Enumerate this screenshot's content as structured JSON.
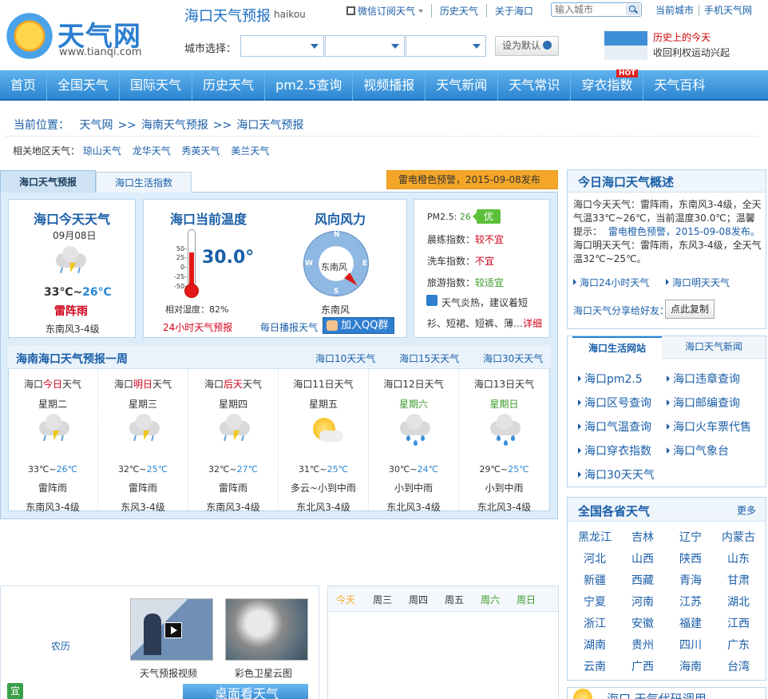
{
  "header": {
    "logo_text": "天气网",
    "logo_url": "www.tianqi.com",
    "city_title": "海口天气预报",
    "city_pinyin": "haikou",
    "top_links": [
      "微信订阅天气",
      "历史天气",
      "关于海口"
    ],
    "search_placeholder": "输入城市",
    "right_links": [
      "当前城市",
      "手机天气网"
    ],
    "city_select_label": "城市选择：",
    "set_default": "设为默认",
    "history_title": "历史上的今天",
    "history_text": "收回利权运动兴起"
  },
  "nav": {
    "items": [
      "首页",
      "全国天气",
      "国际天气",
      "历史天气",
      "pm2.5查询",
      "视频播报",
      "天气新闻",
      "天气常识",
      "穿衣指数",
      "天气百科"
    ],
    "hot_badge": "HOT"
  },
  "breadcrumb": {
    "label": "当前位置：",
    "items": [
      "天气网",
      "海南天气预报",
      "海口天气预报"
    ]
  },
  "related": {
    "label": "相关地区天气：",
    "items": [
      "琼山天气",
      "龙华天气",
      "秀英天气",
      "美兰天气"
    ]
  },
  "tabs": [
    "海口天气预报",
    "海口生活指数"
  ],
  "warning": "雷电橙色预警，2015-09-08发布",
  "today": {
    "title": "海口今天天气",
    "date": "09月08日",
    "high": "33℃",
    "tilde": "~",
    "low": "26℃",
    "condition": "雷阵雨",
    "wind": "东南风3-4级"
  },
  "current": {
    "title": "海口当前温度",
    "temp": "30.0°",
    "scale": [
      "50-",
      "25-",
      "0-",
      "-25-",
      "-50-"
    ],
    "humidity": "相对湿度：82%",
    "forecast_link": "24小时天气预报"
  },
  "wind": {
    "title": "风向风力",
    "direction": "东南风",
    "label": "东南风",
    "dirs": [
      "N",
      "S",
      "W",
      "E"
    ],
    "daily_link": "每日播报天气",
    "qq_button": "加入QQ群"
  },
  "indices": {
    "pm_label": "PM2.5:",
    "pm_value": "26",
    "pm_badge": "优",
    "items": [
      {
        "label": "晨练指数：",
        "value": "较不宜"
      },
      {
        "label": "洗车指数：",
        "value": "不宜"
      },
      {
        "label": "旅游指数：",
        "value": "较适宜"
      }
    ],
    "cloth_line1": "天气炎热，建议着短",
    "cloth_line2": "衫、短裙、短裤、薄…",
    "detail": "详细"
  },
  "week": {
    "title": "海南海口天气预报一周",
    "links": [
      "海口10天天气",
      "海口15天天气",
      "海口30天天气"
    ],
    "days": [
      {
        "pre": "海口",
        "hl": "今日",
        "post": "天气",
        "weekday": "星期二",
        "high": "33℃",
        "low": "26℃",
        "cond": "雷阵雨",
        "wind": "东南风3-4级",
        "icon": "thunder-rain-icon"
      },
      {
        "pre": "海口",
        "hl": "明日",
        "post": "天气",
        "weekday": "星期三",
        "high": "32℃",
        "low": "25℃",
        "cond": "雷阵雨",
        "wind": "东风3-4级",
        "icon": "thunder-rain-icon"
      },
      {
        "pre": "海口",
        "hl": "后天",
        "post": "天气",
        "weekday": "星期四",
        "high": "32℃",
        "low": "27℃",
        "cond": "雷阵雨",
        "wind": "东南风3-4级",
        "icon": "thunder-rain-icon"
      },
      {
        "pre": "海口",
        "hl": "11日",
        "post": "天气",
        "weekday": "星期五",
        "high": "31℃",
        "low": "25℃",
        "cond": "多云~小到中雨",
        "wind": "东北风3-4级",
        "icon": "sun-cloud-icon"
      },
      {
        "pre": "海口",
        "hl": "12日",
        "post": "天气",
        "weekday": "星期六",
        "high": "30℃",
        "low": "24℃",
        "cond": "小到中雨",
        "wind": "东北风3-4级",
        "icon": "rain-icon"
      },
      {
        "pre": "海口",
        "hl": "13日",
        "post": "天气",
        "weekday": "星期日",
        "high": "29℃",
        "low": "25℃",
        "cond": "小到中雨",
        "wind": "东北风3-4级",
        "icon": "rain-icon"
      }
    ]
  },
  "overview": {
    "title": "今日海口天气概述",
    "p1": "海口今天天气：雷阵雨，东南风3-4级，全天气温33℃~26℃，当前温度30.0℃；温馨提示：",
    "p1_warn": "雷电橙色预警，2015-09-08发布。",
    "p2": "海口明天天气：雷阵雨，东风3-4级，全天气温32℃~25℃。",
    "links": [
      "海口24小时天气",
      "海口明天天气"
    ],
    "share_label": "海口天气分享给好友：",
    "copy_button": "点此复制"
  },
  "life": {
    "tabs": [
      "海口生活网站",
      "海口天气新闻"
    ],
    "links": [
      "海口pm2.5",
      "海口违章查询",
      "海口区号查询",
      "海口邮编查询",
      "海口气温查询",
      "海口火车票代售",
      "海口穿衣指数",
      "海口气象台",
      "海口30天天气"
    ]
  },
  "provinces": {
    "title": "全国各省天气",
    "more": "更多",
    "items": [
      "黑龙江",
      "吉林",
      "辽宁",
      "内蒙古",
      "河北",
      "山西",
      "陕西",
      "山东",
      "新疆",
      "西藏",
      "青海",
      "甘肃",
      "宁夏",
      "河南",
      "江苏",
      "湖北",
      "浙江",
      "安徽",
      "福建",
      "江西",
      "湖南",
      "贵州",
      "四川",
      "广东",
      "云南",
      "广西",
      "海南",
      "台湾"
    ]
  },
  "bottom": {
    "lunar": "农历",
    "video_caption": "天气预报视频",
    "satellite_caption": "彩色卫星云图",
    "desktop_button": "桌面看天气",
    "yi_badge": "宜",
    "day_tabs": [
      "今天",
      "周三",
      "周四",
      "周五",
      "周六",
      "周日"
    ],
    "right_partial": "海口 天气代码调用"
  },
  "colors": {
    "accent": "#2b86d2",
    "warning": "#f5a628",
    "danger": "#d0021b",
    "good": "#3a9a2a"
  }
}
